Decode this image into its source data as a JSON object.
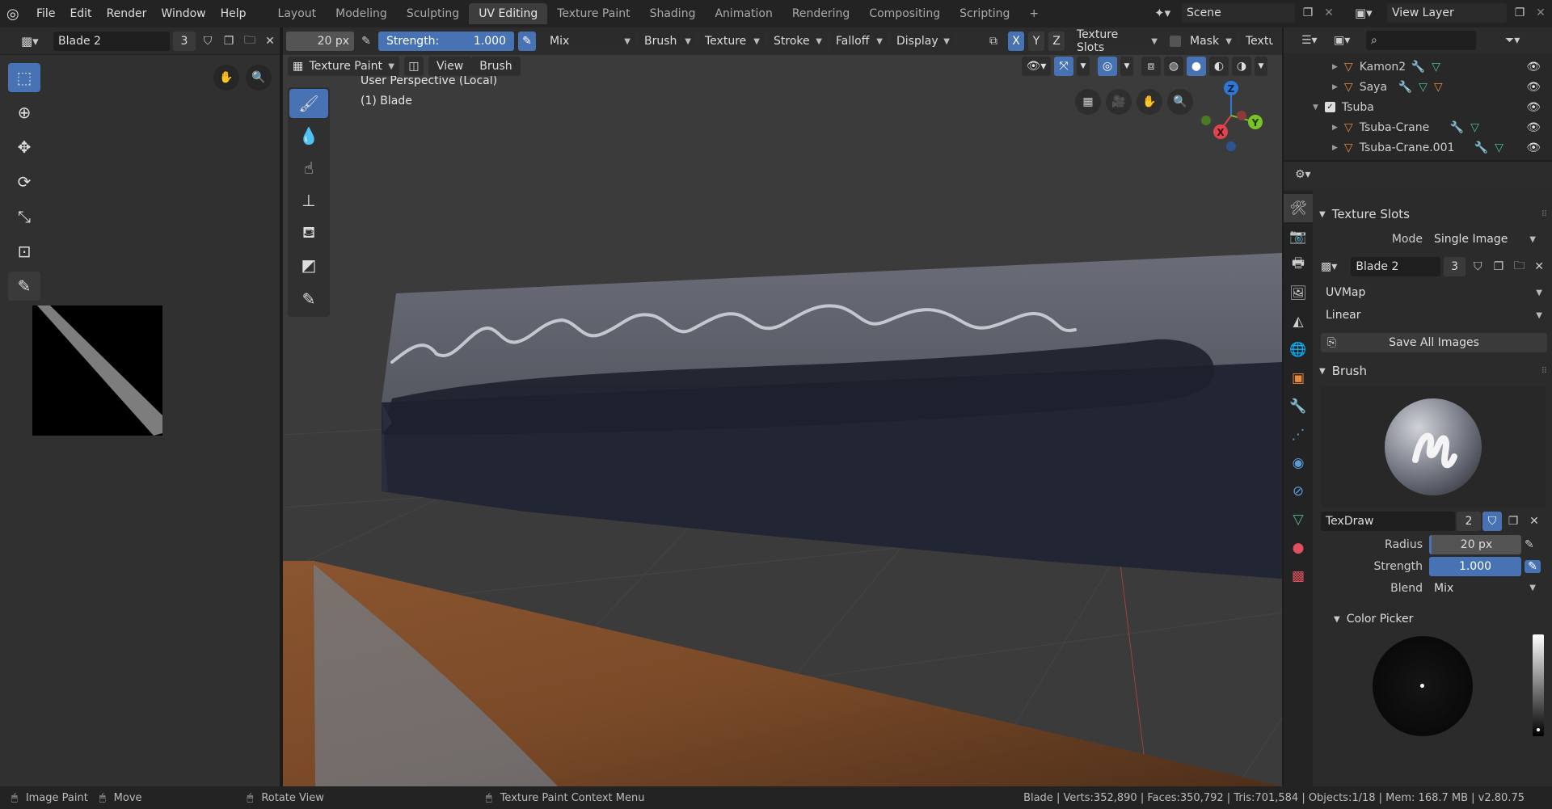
{
  "topbar": {
    "menus": [
      "File",
      "Edit",
      "Render",
      "Window",
      "Help"
    ],
    "workspaces": [
      "Layout",
      "Modeling",
      "Sculpting",
      "UV Editing",
      "Texture Paint",
      "Shading",
      "Animation",
      "Rendering",
      "Compositing",
      "Scripting"
    ],
    "active_workspace": "UV Editing",
    "add_tab": "+",
    "scene": "Scene",
    "view_layer": "View Layer"
  },
  "image_editor": {
    "image_name": "Blade 2",
    "users": "3"
  },
  "tool_settings": {
    "radius": "20 px",
    "strength_label": "Strength:",
    "strength_value": "1.000",
    "blend": "Mix",
    "menus": [
      "Brush",
      "Texture",
      "Stroke",
      "Falloff",
      "Display"
    ],
    "axes": [
      "X",
      "Y",
      "Z"
    ],
    "texture_slots": "Texture Slots",
    "mask": "Mask",
    "texture": "Texture"
  },
  "viewport": {
    "mode": "Texture Paint",
    "menus": [
      "View",
      "Brush"
    ],
    "perspective": "User Perspective (Local)",
    "object": "(1) Blade",
    "gizmo": {
      "z": "Z",
      "x": "X",
      "y": "Y"
    }
  },
  "outliner": {
    "items": [
      {
        "name": "Kamon2",
        "indent": 2
      },
      {
        "name": "Saya",
        "indent": 2
      },
      {
        "name": "Tsuba",
        "indent": 1
      },
      {
        "name": "Tsuba-Crane",
        "indent": 2
      },
      {
        "name": "Tsuba-Crane.001",
        "indent": 2
      }
    ]
  },
  "properties": {
    "texture_slots_title": "Texture Slots",
    "mode_label": "Mode",
    "mode_value": "Single Image",
    "image_name": "Blade 2",
    "image_users": "3",
    "uvmap": "UVMap",
    "interpolation": "Linear",
    "save_all": "Save All Images",
    "brush_title": "Brush",
    "brush_name": "TexDraw",
    "brush_users": "2",
    "radius_label": "Radius",
    "radius_value": "20 px",
    "strength_label": "Strength",
    "strength_value": "1.000",
    "blend_label": "Blend",
    "blend_value": "Mix",
    "color_picker": "Color Picker"
  },
  "statusbar": {
    "image_paint": "Image Paint",
    "move": "Move",
    "rotate": "Rotate View",
    "context_menu": "Texture Paint Context Menu",
    "stats": "Blade | Verts:352,890 | Faces:350,792 | Tris:701,584 | Objects:1/18 | Mem: 168.7 MB | v2.80.75"
  },
  "colors": {
    "accent": "#4772b3",
    "active_tab": "#3d3d3d",
    "object_orange": "#e8883a"
  }
}
